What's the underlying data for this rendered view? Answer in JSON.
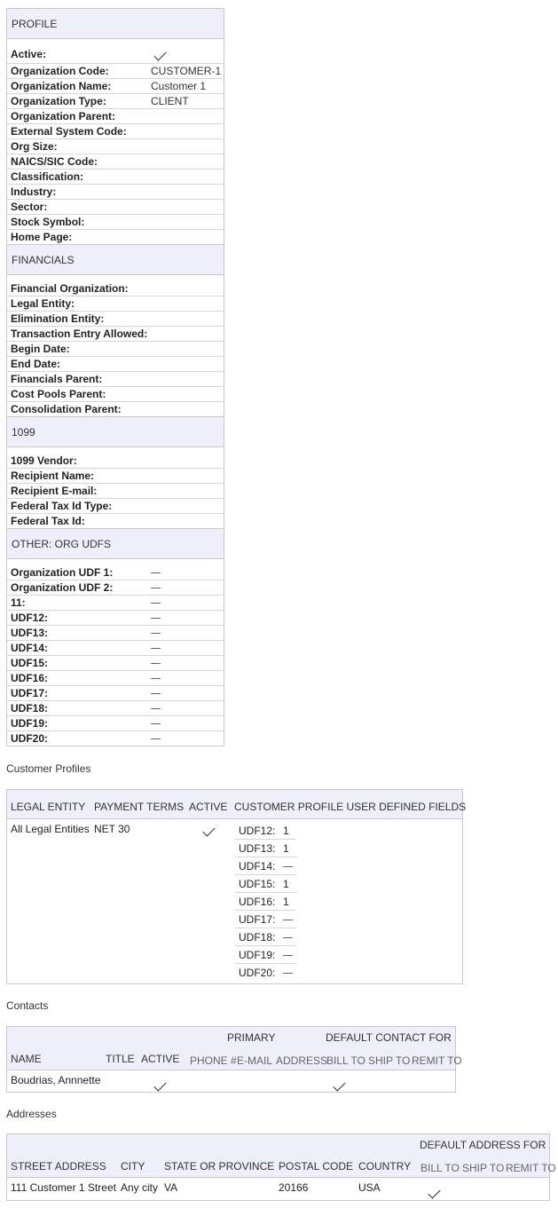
{
  "sections": [
    {
      "title": "PROFILE",
      "rows": [
        {
          "label": "Active:",
          "value": "",
          "type": "check"
        },
        {
          "label": "Organization Code:",
          "value": "CUSTOMER-1"
        },
        {
          "label": "Organization Name:",
          "value": "Customer 1"
        },
        {
          "label": "Organization Type:",
          "value": "CLIENT"
        },
        {
          "label": "Organization Parent:",
          "value": ""
        },
        {
          "label": "External System Code:",
          "value": ""
        },
        {
          "label": "Org Size:",
          "value": ""
        },
        {
          "label": "NAICS/SIC Code:",
          "value": ""
        },
        {
          "label": "Classification:",
          "value": ""
        },
        {
          "label": "Industry:",
          "value": ""
        },
        {
          "label": "Sector:",
          "value": ""
        },
        {
          "label": "Stock Symbol:",
          "value": ""
        },
        {
          "label": "Home Page:",
          "value": ""
        }
      ]
    },
    {
      "title": "FINANCIALS",
      "rows": [
        {
          "label": "Financial Organization:",
          "value": ""
        },
        {
          "label": "Legal Entity:",
          "value": ""
        },
        {
          "label": "Elimination Entity:",
          "value": ""
        },
        {
          "label": "Transaction Entry Allowed:",
          "value": ""
        },
        {
          "label": "Begin Date:",
          "value": ""
        },
        {
          "label": "End Date:",
          "value": ""
        },
        {
          "label": "Financials Parent:",
          "value": ""
        },
        {
          "label": "Cost Pools Parent:",
          "value": ""
        },
        {
          "label": "Consolidation Parent:",
          "value": ""
        }
      ]
    },
    {
      "title": "1099",
      "rows": [
        {
          "label": "1099 Vendor:",
          "value": ""
        },
        {
          "label": "Recipient Name:",
          "value": ""
        },
        {
          "label": "Recipient E-mail:",
          "value": ""
        },
        {
          "label": "Federal Tax Id Type:",
          "value": ""
        },
        {
          "label": "Federal Tax Id:",
          "value": ""
        }
      ]
    },
    {
      "title": "OTHER: ORG UDFS",
      "rows": [
        {
          "label": "Organization UDF 1:",
          "value": "",
          "type": "dash"
        },
        {
          "label": "Organization UDF 2:",
          "value": "",
          "type": "dash"
        },
        {
          "label": "11:",
          "value": "",
          "type": "dash"
        },
        {
          "label": "UDF12:",
          "value": "",
          "type": "dash"
        },
        {
          "label": "UDF13:",
          "value": "",
          "type": "dash"
        },
        {
          "label": "UDF14:",
          "value": "",
          "type": "dash"
        },
        {
          "label": "UDF15:",
          "value": "",
          "type": "dash"
        },
        {
          "label": "UDF16:",
          "value": "",
          "type": "dash"
        },
        {
          "label": "UDF17:",
          "value": "",
          "type": "dash"
        },
        {
          "label": "UDF18:",
          "value": "",
          "type": "dash"
        },
        {
          "label": "UDF19:",
          "value": "",
          "type": "dash"
        },
        {
          "label": "UDF20:",
          "value": "",
          "type": "dash"
        }
      ]
    }
  ],
  "customer_profiles": {
    "caption": "Customer Profiles",
    "headers": {
      "legal_entity": "LEGAL ENTITY",
      "payment_terms": "PAYMENT TERMS",
      "active": "ACTIVE",
      "udfs": "CUSTOMER PROFILE USER DEFINED FIELDS"
    },
    "row": {
      "legal_entity": "All Legal Entities",
      "payment_terms": "NET 30",
      "active": true
    },
    "udfs": [
      {
        "label": "UDF12:",
        "value": "1"
      },
      {
        "label": "UDF13:",
        "value": "1"
      },
      {
        "label": "UDF14:",
        "value": ""
      },
      {
        "label": "UDF15:",
        "value": "1"
      },
      {
        "label": "UDF16:",
        "value": "1"
      },
      {
        "label": "UDF17:",
        "value": ""
      },
      {
        "label": "UDF18:",
        "value": ""
      },
      {
        "label": "UDF19:",
        "value": ""
      },
      {
        "label": "UDF20:",
        "value": ""
      }
    ]
  },
  "contacts": {
    "caption": "Contacts",
    "group_primary": "PRIMARY",
    "group_default": "DEFAULT CONTACT FOR",
    "headers": {
      "name": "NAME",
      "title": "TITLE",
      "active": "ACTIVE",
      "phone": "PHONE #",
      "email": "E-MAIL",
      "address": "ADDRESS",
      "bill_to": "BILL TO",
      "ship_to": "SHIP TO",
      "remit_to": "REMIT TO"
    },
    "row": {
      "name": "Boudrias, Annnette",
      "active": true,
      "bill_to": true
    }
  },
  "addresses": {
    "caption": "Addresses",
    "group_default": "DEFAULT ADDRESS FOR",
    "headers": {
      "street": "STREET ADDRESS",
      "city": "CITY",
      "state": "STATE OR PROVINCE",
      "postal": "POSTAL CODE",
      "country": "COUNTRY",
      "bill_to": "BILL TO",
      "ship_to": "SHIP TO",
      "remit_to": "REMIT TO"
    },
    "row": {
      "street": "111 Customer 1 Street",
      "city": "Any city",
      "state": "VA",
      "postal": "20166",
      "country": "USA",
      "bill_to": true
    }
  }
}
